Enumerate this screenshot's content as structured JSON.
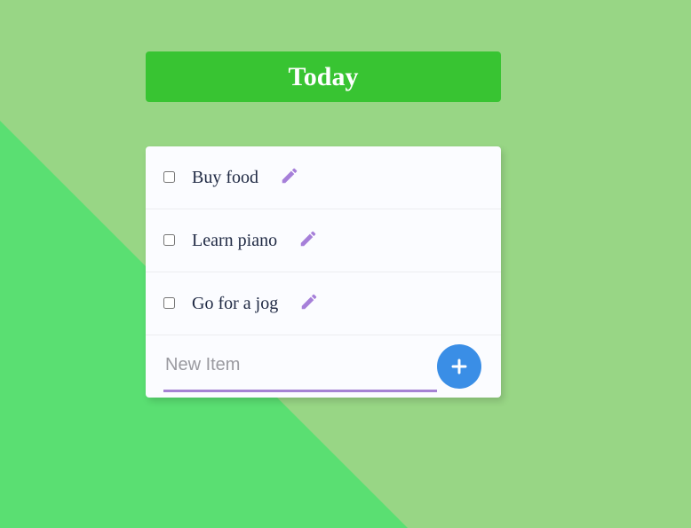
{
  "header": {
    "title": "Today"
  },
  "items": [
    {
      "label": "Buy food",
      "checked": false
    },
    {
      "label": "Learn piano",
      "checked": false
    },
    {
      "label": "Go for a jog",
      "checked": false
    }
  ],
  "new_item": {
    "placeholder": "New Item",
    "value": ""
  },
  "add_button": {
    "icon": "plus-icon"
  },
  "colors": {
    "background": "#98d685",
    "background_triangle": "#5adf72",
    "header": "#38c432",
    "accent": "#a683d4",
    "add_button": "#3a8ee6"
  }
}
